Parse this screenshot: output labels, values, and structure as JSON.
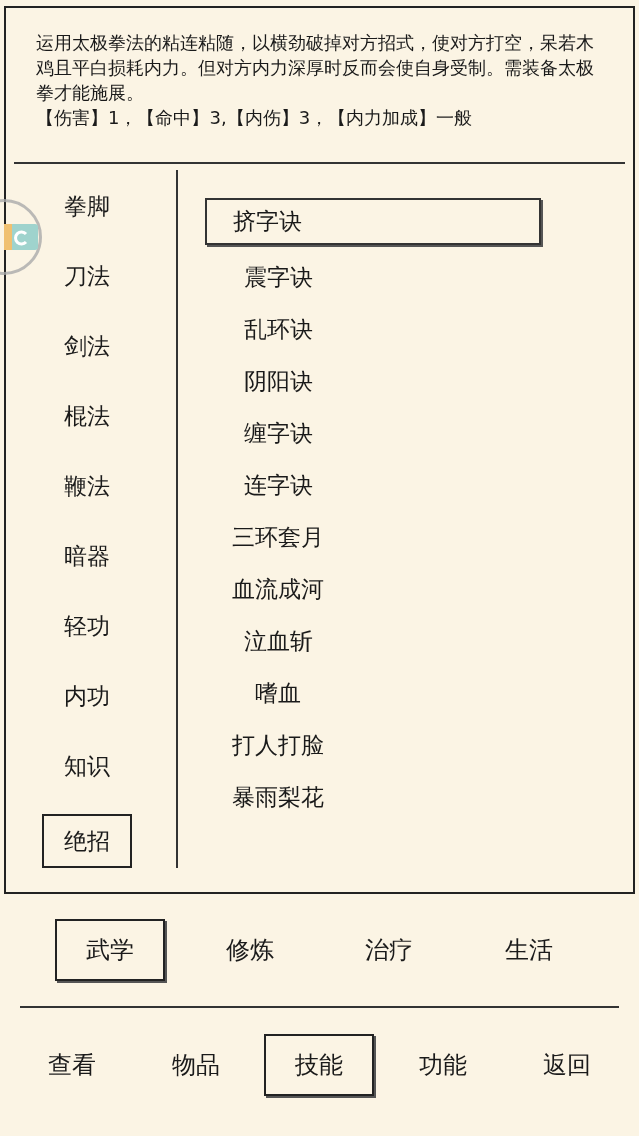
{
  "description": {
    "text": "运用太极拳法的粘连粘随，以横劲破掉对方招式，使对方打空，呆若木鸡且平白损耗内力。但对方内力深厚时反而会使自身受制。需装备太极拳才能施展。",
    "stats": "【伤害】1，【命中】3,【内伤】3，【内力加成】一般"
  },
  "categories": [
    {
      "label": "拳脚",
      "selected": false
    },
    {
      "label": "刀法",
      "selected": false
    },
    {
      "label": "剑法",
      "selected": false
    },
    {
      "label": "棍法",
      "selected": false
    },
    {
      "label": "鞭法",
      "selected": false
    },
    {
      "label": "暗器",
      "selected": false
    },
    {
      "label": "轻功",
      "selected": false
    },
    {
      "label": "内功",
      "selected": false
    },
    {
      "label": "知识",
      "selected": false
    },
    {
      "label": "绝招",
      "selected": true
    }
  ],
  "skills": [
    {
      "label": "挤字诀",
      "selected": true
    },
    {
      "label": "震字诀",
      "selected": false
    },
    {
      "label": "乱环诀",
      "selected": false
    },
    {
      "label": "阴阳诀",
      "selected": false
    },
    {
      "label": "缠字诀",
      "selected": false
    },
    {
      "label": "连字诀",
      "selected": false
    },
    {
      "label": "三环套月",
      "selected": false
    },
    {
      "label": "血流成河",
      "selected": false
    },
    {
      "label": "泣血斩",
      "selected": false
    },
    {
      "label": "嗜血",
      "selected": false
    },
    {
      "label": "打人打脸",
      "selected": false
    },
    {
      "label": "暴雨梨花",
      "selected": false
    }
  ],
  "tabs": [
    {
      "label": "武学",
      "selected": true
    },
    {
      "label": "修炼",
      "selected": false
    },
    {
      "label": "治疗",
      "selected": false
    },
    {
      "label": "生活",
      "selected": false
    }
  ],
  "nav": [
    {
      "label": "查看",
      "selected": false
    },
    {
      "label": "物品",
      "selected": false
    },
    {
      "label": "技能",
      "selected": true
    },
    {
      "label": "功能",
      "selected": false
    },
    {
      "label": "返回",
      "selected": false
    }
  ]
}
